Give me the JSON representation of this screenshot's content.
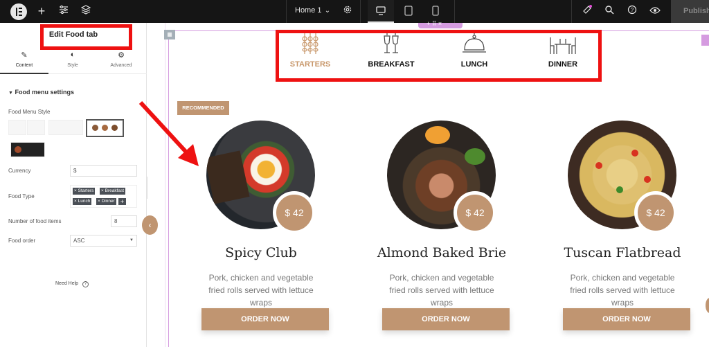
{
  "topbar": {
    "page_name": "Home 1",
    "publish_label": "Publish"
  },
  "panel": {
    "title": "Edit Food tab",
    "tabs": [
      {
        "label": "Content",
        "icon": "pencil-icon"
      },
      {
        "label": "Style",
        "icon": "half-circle-icon"
      },
      {
        "label": "Advanced",
        "icon": "gear-icon"
      }
    ],
    "section_heading": "Food menu settings",
    "food_menu_style_label": "Food Menu Style",
    "currency_label": "Currency",
    "currency_value": "$",
    "food_type_label": "Food Type",
    "food_types": [
      "Starters",
      "Breakfast",
      "Lunch",
      "Dinner"
    ],
    "number_label": "Number of food items",
    "number_value": "8",
    "order_label": "Food order",
    "order_value": "ASC",
    "need_help": "Need Help"
  },
  "canvas": {
    "categories": [
      {
        "label": "STARTERS",
        "icon": "skewers-icon",
        "active": true
      },
      {
        "label": "BREAKFAST",
        "icon": "drinks-icon",
        "active": false
      },
      {
        "label": "LUNCH",
        "icon": "cloche-icon",
        "active": false
      },
      {
        "label": "DINNER",
        "icon": "dining-table-icon",
        "active": false
      }
    ],
    "badge": "RECOMMENDED",
    "cards": [
      {
        "name": "Spicy Club",
        "price": "$ 42",
        "desc": "Pork, chicken and vegetable fried rolls served with lettuce wraps",
        "button": "ORDER NOW"
      },
      {
        "name": "Almond Baked Brie",
        "price": "$ 42",
        "desc": "Pork, chicken and vegetable fried rolls served with lettuce wraps",
        "button": "ORDER NOW"
      },
      {
        "name": "Tuscan Flatbread",
        "price": "$ 42",
        "desc": "Pork, chicken and vegetable fried rolls served with lettuce wraps",
        "button": "ORDER NOW"
      }
    ]
  },
  "colors": {
    "accent": "#c09571",
    "annotation_red": "#ee1111",
    "topbar_bg": "#151515"
  }
}
